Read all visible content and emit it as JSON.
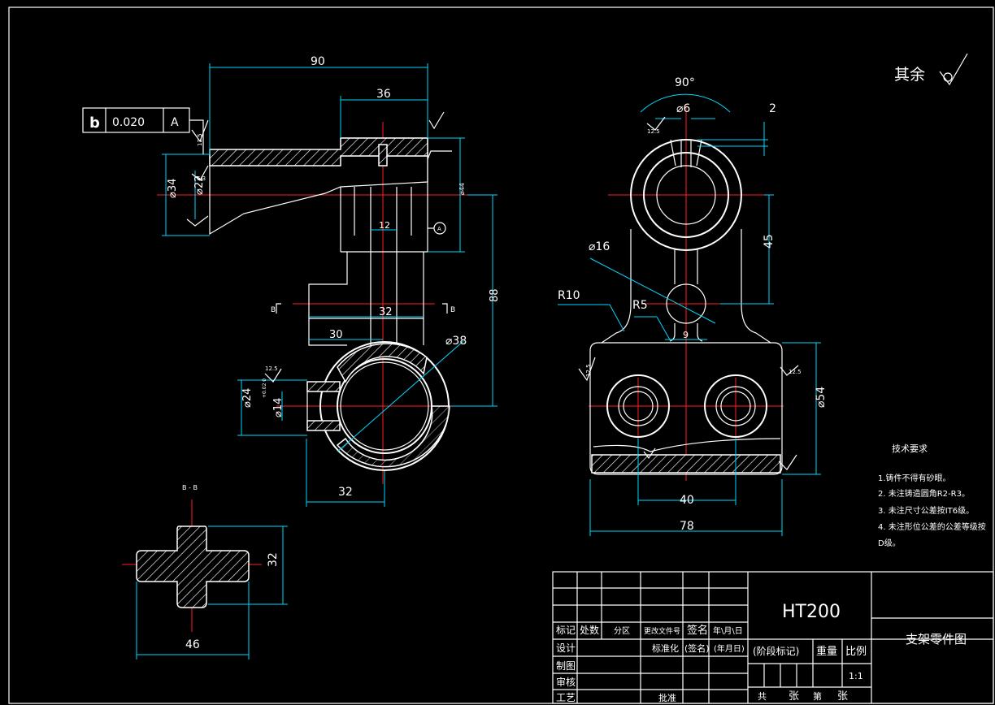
{
  "drawing": {
    "surface_finish_note": {
      "text": "其余"
    },
    "left_view": {
      "dim_90": "90",
      "dim_36": "36",
      "dim_12": "12",
      "dim_88": "88",
      "dim_32_mid": "32",
      "dim_30": "30",
      "dim_38": "⌀38",
      "dim_34": "⌀34",
      "dim_22": "⌀22",
      "dim_24": "⌀24",
      "dim_14": "⌀14",
      "dim_14_tol": "+0.02  0",
      "dim_32_bottom": "32",
      "dim_44": "⌀44",
      "roughness_a": "12.5",
      "roughness_b": "6.3",
      "roughness_c": "12.5",
      "section_marker_left": "B",
      "section_marker_right": "B"
    },
    "tolerance_frame": {
      "symbol": "b",
      "value": "0.020",
      "datum": "A"
    },
    "datum_label": "A",
    "right_view": {
      "angle": "90°",
      "dim_6": "⌀6",
      "dim_2": "2",
      "dim_45": "45",
      "dim_16": "⌀16",
      "r10": "R10",
      "r5": "R5",
      "dim_9": "9",
      "dim_54": "⌀54",
      "dim_40": "40",
      "dim_78": "78",
      "roughness_left": "12.5",
      "roughness_right": "12.5",
      "roughness_top": "12.5"
    },
    "section_view": {
      "title": "B - B",
      "dim_32": "32",
      "dim_46": "46"
    },
    "tech_requirements": {
      "title": "技术要求",
      "items": [
        "1.铸件不得有砂眼。",
        "2. 未注铸造圆角R2-R3。",
        "3. 未注尺寸公差按IT6级。",
        "4. 未注形位公差的公差等级按",
        "D级。"
      ]
    }
  },
  "title_block": {
    "material": "HT200",
    "part_name": "支架零件图",
    "headers": [
      "标记",
      "处数",
      "分区",
      "更改文件号",
      "签名",
      "年\\月\\日"
    ],
    "rows": [
      [
        "设计",
        "标准化",
        "(签名)",
        "(年月日)"
      ],
      [
        "制图"
      ],
      [
        "审核"
      ],
      [
        "工艺",
        "批准"
      ]
    ],
    "stage_label": "(阶段标记)",
    "weight_label": "重量",
    "scale_label": "比例",
    "scale_value": "1:1",
    "sheet_total_label": "共",
    "sheet_unit": "张",
    "sheet_no_label": "第",
    "sheet_unit_2": "张"
  }
}
